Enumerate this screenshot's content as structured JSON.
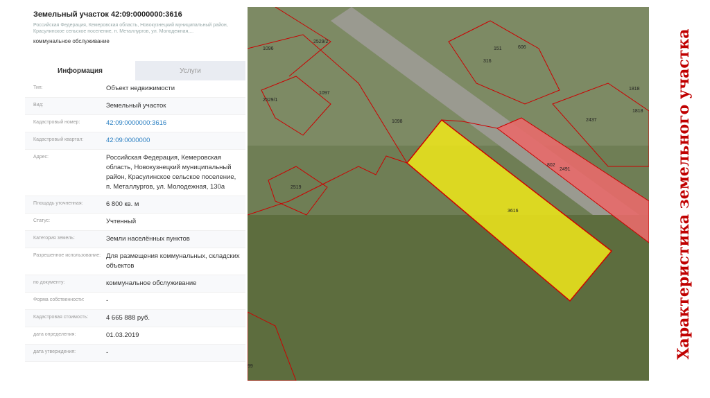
{
  "panel": {
    "title": "Земельный участок 42:09:0000000:3616",
    "address": "Российская Федерация, Кемеровская область, Новокузнецкий муниципальный район, Красулинское сельское поселение, п. Металлургов, ул. Молодежная,...",
    "use": "коммунальное обслуживание",
    "tabs": [
      "Информация",
      "Услуги"
    ],
    "rows": [
      {
        "label": "Тип:",
        "value": "Объект недвижимости"
      },
      {
        "label": "Вид:",
        "value": "Земельный участок"
      },
      {
        "label": "Кадастровый номер:",
        "value": "42:09:0000000:3616"
      },
      {
        "label": "Кадастровый квартал:",
        "value": "42:09:0000000"
      },
      {
        "label": "Адрес:",
        "value": "Российская Федерация, Кемеровская область, Новокузнецкий муниципальный район, Красулинское сельское поселение, п. Металлургов, ул. Молодежная, 130а"
      },
      {
        "label": "Площадь уточненная:",
        "value": "6 800 кв. м"
      },
      {
        "label": "Статус:",
        "value": "Учтенный"
      },
      {
        "label": "Категория земель:",
        "value": "Земли населённых пунктов"
      },
      {
        "label": "Разрешенное использование:",
        "value": "Для размещения коммунальных, складских объектов"
      },
      {
        "label": "по документу:",
        "value": "коммунальное обслуживание"
      },
      {
        "label": "Форма собственности:",
        "value": "-"
      },
      {
        "label": "Кадастровая стоимость:",
        "value": "4 665 888 руб."
      },
      {
        "label": "дата определения:",
        "value": "01.03.2019"
      },
      {
        "label": "дата утверждения:",
        "value": "-"
      }
    ]
  },
  "map": {
    "labels": [
      "1096",
      "2529/2",
      "151",
      "606",
      "316",
      "1097",
      "2529/1",
      "1098",
      "1818",
      "2437",
      "1818",
      "802",
      "2491",
      "2519",
      "3616",
      "99"
    ]
  },
  "side_title": "Характеристика земельного участка"
}
